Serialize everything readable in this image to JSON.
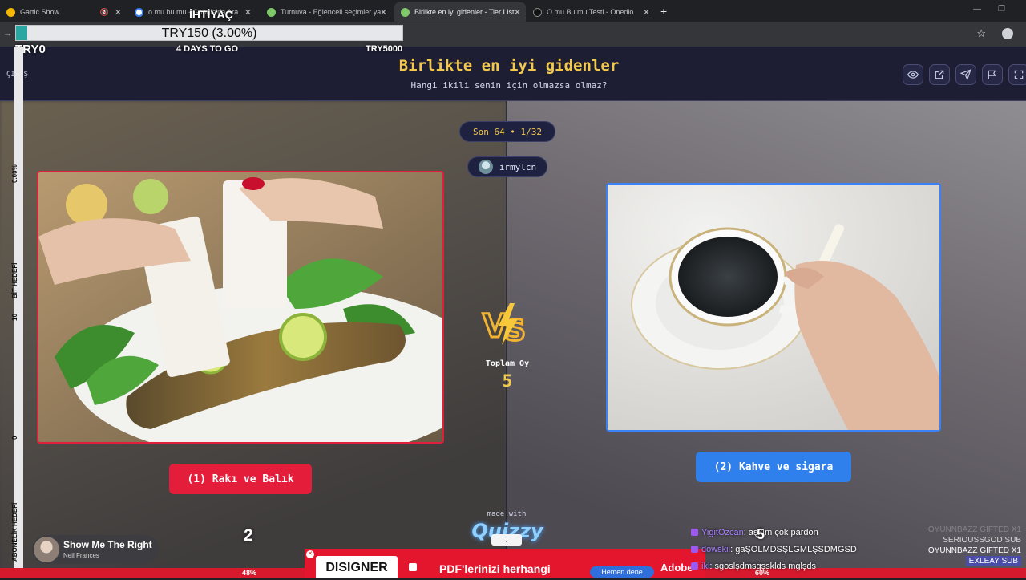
{
  "browser": {
    "tabs": [
      {
        "label": "Gartic Show",
        "color": "#f5b700"
      },
      {
        "label": "o mu bu mu - Google'da Ara",
        "color": "#ffffff"
      },
      {
        "label": "Turnuva - Eğlenceli seçimler ya",
        "color": "#7ec86a"
      },
      {
        "label": "Birlikte en iyi gidenler - Tier List",
        "color": "#7ec86a"
      },
      {
        "label": "O mu Bu mu Testi - Onedio",
        "color": "#111111"
      }
    ],
    "new_tab": "+"
  },
  "donation_goal": {
    "heading": "İHTİYAÇ",
    "progress_text": "TRY150 (3.00%)",
    "progress_fraction": 0.03,
    "min_label": "TRY0",
    "days_label": "4 DAYS TO GO",
    "max_label": "TRY5000"
  },
  "site": {
    "exit_label": "ÇIKIŞ",
    "title": "Birlikte en iyi gidenler",
    "subtitle": "Hangi ikili senin için olmazsa olmaz?",
    "round": "Son 64 • 1/32",
    "user": "irmylcn",
    "left_choice": "(1) Rakı ve Balık",
    "right_choice": "(2) Kahve ve sigara",
    "total_label": "Toplam Oy",
    "total_value": "5",
    "made_with": "made with",
    "brand": "Quizzy",
    "colors": {
      "left": "#e41d3a",
      "right": "#2f80ed",
      "accent": "#f2c94c",
      "header_bg": "#1d1e33"
    }
  },
  "side_panel": {
    "labels": [
      "0.00%",
      "BİT HEDEFİ",
      "10",
      "0",
      "ABONELİK HEDEFİ"
    ]
  },
  "music": {
    "title": "Show Me The Right",
    "artist": "Neil Frances"
  },
  "overlay_numbers": {
    "left": "2",
    "center": "5"
  },
  "percent_bar": {
    "left": "48%",
    "right": "60%"
  },
  "ad": {
    "logo": "DISIGNER",
    "text": "PDF'lerinizi herhangi",
    "button": "Hemen dene",
    "brand": "Adobe"
  },
  "chat": [
    {
      "user": "YigitOzcan",
      "message": "aşkım çok pardon"
    },
    {
      "user": "dowskii",
      "message": "gaŞOLMDSŞLGMLŞSDMGSD"
    },
    {
      "user": "ikl",
      "message": "sgoslşdmsgşsklds mglşds"
    }
  ],
  "subs": [
    {
      "text": "OYUNNBAZZ  GIFTED X1",
      "tone": "dim"
    },
    {
      "text": "SERIOUSSGOD  SUB",
      "tone": "mid"
    },
    {
      "text": "OYUNNBAZZ  GIFTED X1",
      "tone": "full"
    },
    {
      "text": "EXLEAY  SUB",
      "tone": "hl"
    }
  ]
}
